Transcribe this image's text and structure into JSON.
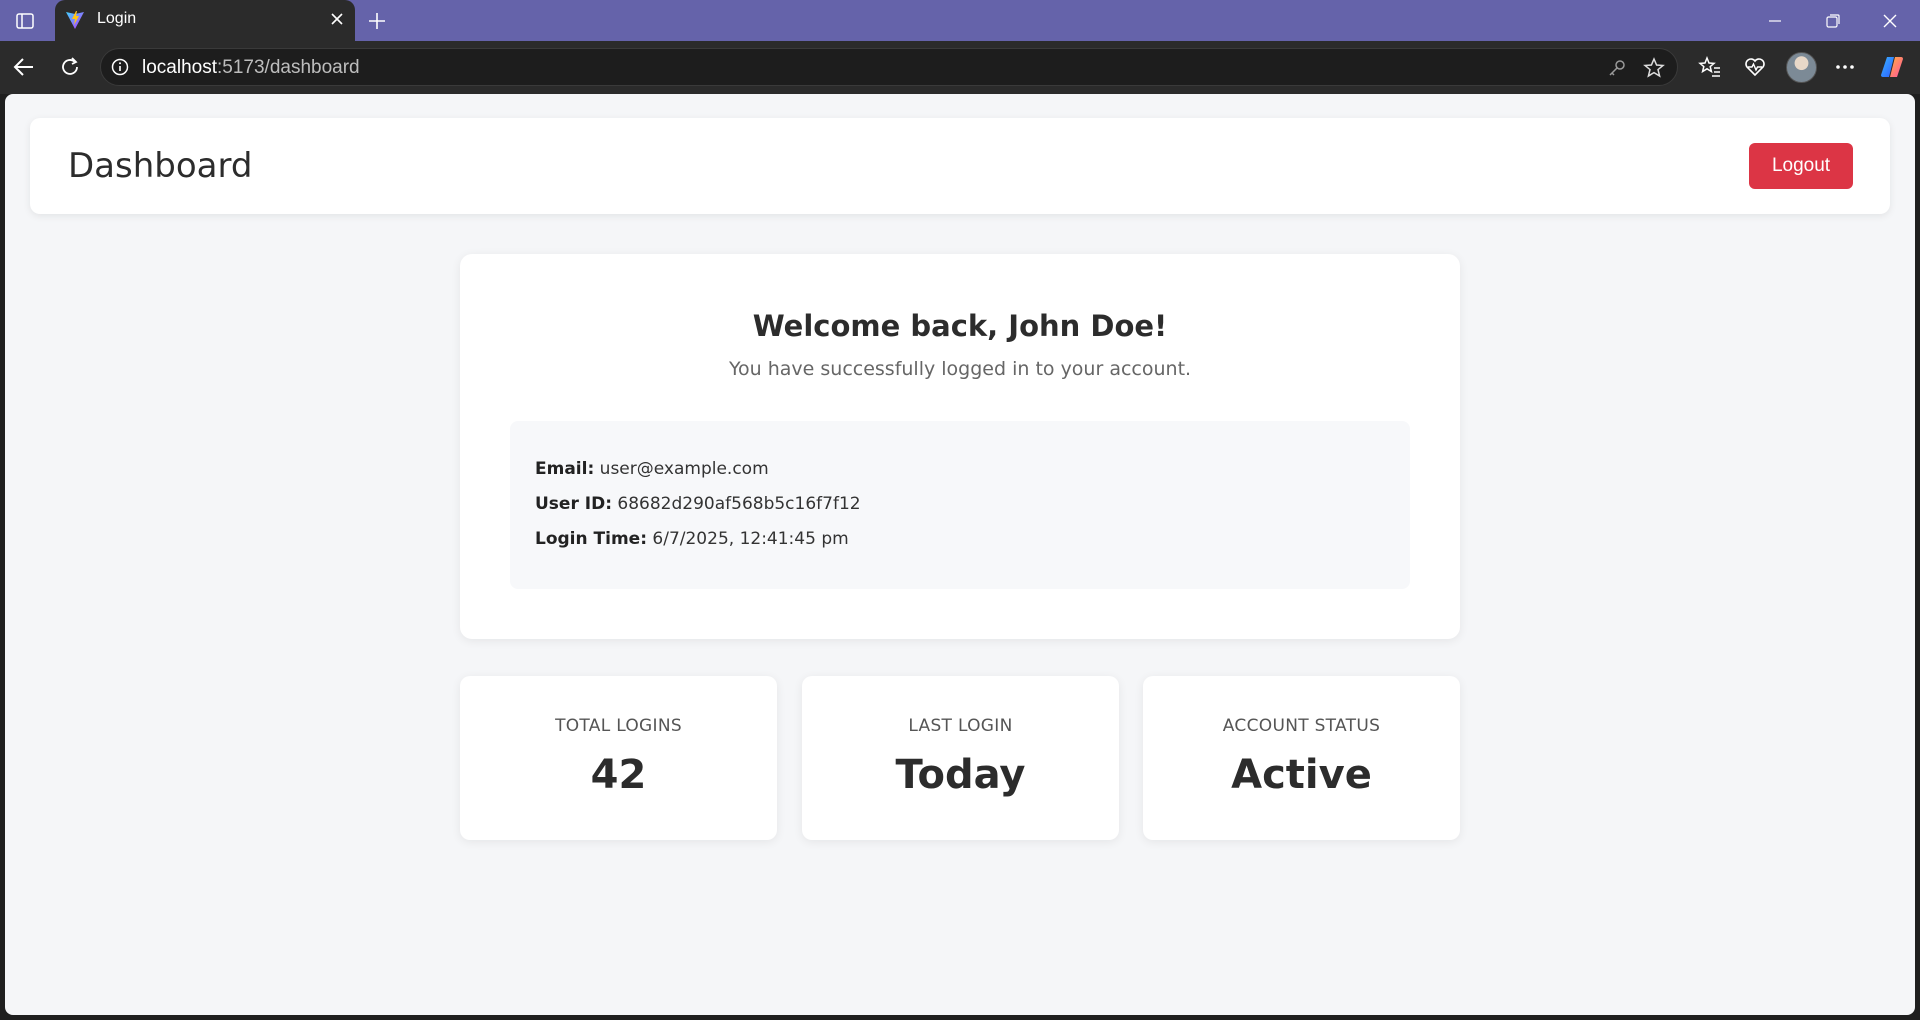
{
  "browser": {
    "tab_title": "Login",
    "url_host": "localhost",
    "url_path": ":5173/dashboard"
  },
  "header": {
    "title": "Dashboard",
    "logout_label": "Logout"
  },
  "welcome": {
    "title": "Welcome back, John Doe!",
    "subtitle": "You have successfully logged in to your account.",
    "details": {
      "email_label": "Email:",
      "email_value": "user@example.com",
      "user_id_label": "User ID:",
      "user_id_value": "68682d290af568b5c16f7f12",
      "login_time_label": "Login Time:",
      "login_time_value": "6/7/2025, 12:41:45 pm"
    }
  },
  "stats": [
    {
      "label": "TOTAL LOGINS",
      "value": "42"
    },
    {
      "label": "LAST LOGIN",
      "value": "Today"
    },
    {
      "label": "ACCOUNT STATUS",
      "value": "Active"
    }
  ],
  "colors": {
    "titlebar": "#6563aa",
    "logout_button": "#dc3545",
    "page_background": "#f5f6f8"
  },
  "icons": [
    "sidebar-icon",
    "vite-favicon-icon",
    "close-icon",
    "new-tab-icon",
    "minimize-icon",
    "restore-icon",
    "window-close-icon",
    "back-icon",
    "refresh-icon",
    "info-icon",
    "key-icon",
    "star-icon",
    "favorites-icon",
    "health-icon",
    "more-icon",
    "copilot-icon"
  ]
}
